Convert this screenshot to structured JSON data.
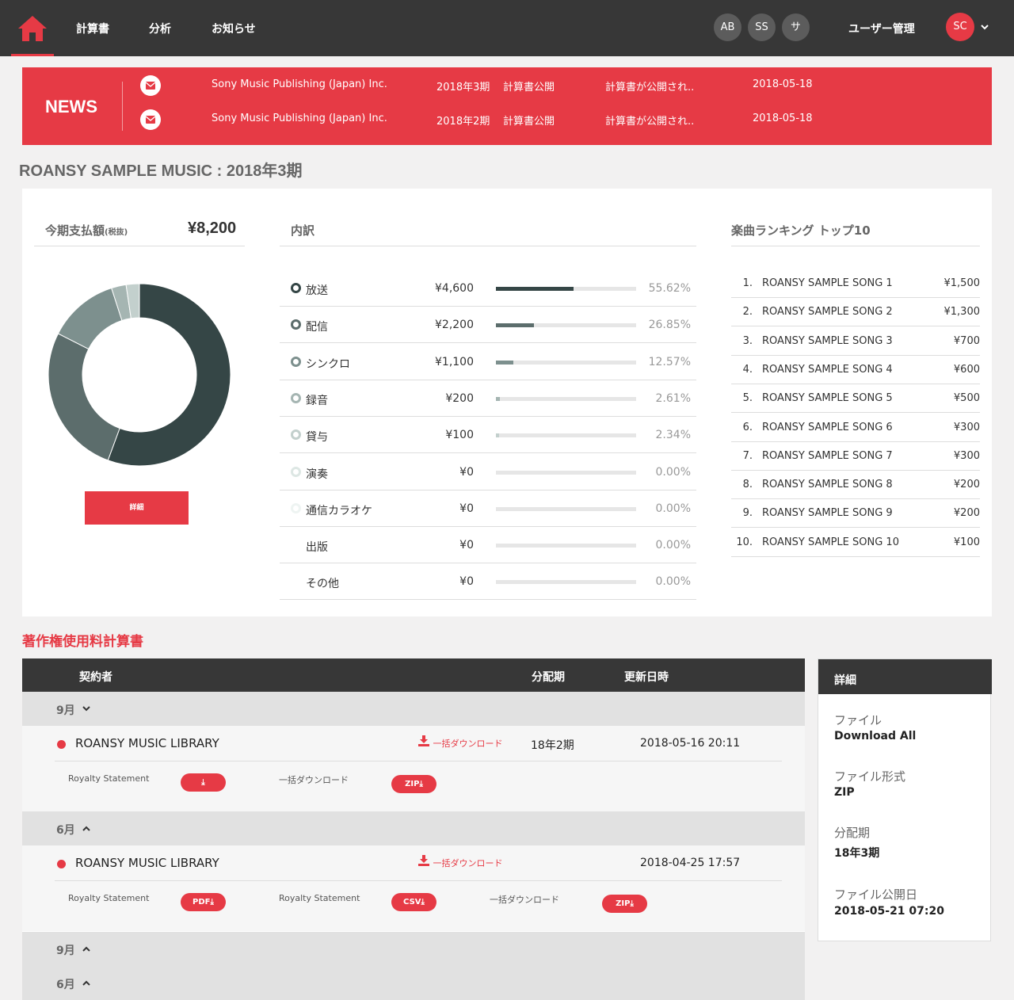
{
  "nav": {
    "items": [
      "計算書",
      "分析",
      "お知らせ"
    ],
    "avatars": [
      "AB",
      "SS",
      "サ"
    ],
    "user_mgmt": "ユーザー管理",
    "me": "SC"
  },
  "news": {
    "title": "NEWS",
    "items": [
      {
        "publisher": "Sony Music Publishing (Japan) Inc.",
        "period": "2018年3期",
        "type": "計算書公開",
        "msg": "計算書が公開され..",
        "date": "2018-05-18"
      },
      {
        "publisher": "Sony Music Publishing (Japan) Inc.",
        "period": "2018年2期",
        "type": "計算書公開",
        "msg": "計算書が公開され..",
        "date": "2018-05-18"
      }
    ]
  },
  "page_title": "ROANSY SAMPLE MUSIC : 2018年3期",
  "summary": {
    "label": "今期支払額",
    "label_small": "(税抜)",
    "total": "¥8,200",
    "detail_button": "詳細"
  },
  "breakdown": {
    "title": "内訳",
    "colors": [
      "#354646",
      "#5c6d6c",
      "#7d908e",
      "#a5b5b2",
      "#c3d0cd",
      "#dde7e4",
      "#eef4f2",
      "#ffffff",
      "#ffffff"
    ],
    "rows": [
      {
        "label": "放送",
        "amount": "¥4,600",
        "pct": "55.62%",
        "ratio": 0.5562
      },
      {
        "label": "配信",
        "amount": "¥2,200",
        "pct": "26.85%",
        "ratio": 0.2685
      },
      {
        "label": "シンクロ",
        "amount": "¥1,100",
        "pct": "12.57%",
        "ratio": 0.1257
      },
      {
        "label": "録音",
        "amount": "¥200",
        "pct": "2.61%",
        "ratio": 0.0261
      },
      {
        "label": "貸与",
        "amount": "¥100",
        "pct": "2.34%",
        "ratio": 0.0234
      },
      {
        "label": "演奏",
        "amount": "¥0",
        "pct": "0.00%",
        "ratio": 0
      },
      {
        "label": "通信カラオケ",
        "amount": "¥0",
        "pct": "0.00%",
        "ratio": 0
      },
      {
        "label": "出版",
        "amount": "¥0",
        "pct": "0.00%",
        "ratio": 0
      },
      {
        "label": "その他",
        "amount": "¥0",
        "pct": "0.00%",
        "ratio": 0
      }
    ]
  },
  "ranking": {
    "title": "楽曲ランキング トップ10",
    "rows": [
      {
        "n": "1.",
        "title": "ROANSY SAMPLE SONG 1",
        "value": "¥1,500"
      },
      {
        "n": "2.",
        "title": "ROANSY SAMPLE SONG 2",
        "value": "¥1,300"
      },
      {
        "n": "3.",
        "title": "ROANSY SAMPLE SONG 3",
        "value": "¥700"
      },
      {
        "n": "4.",
        "title": "ROANSY SAMPLE SONG 4",
        "value": "¥600"
      },
      {
        "n": "5.",
        "title": "ROANSY SAMPLE SONG 5",
        "value": "¥500"
      },
      {
        "n": "6.",
        "title": "ROANSY SAMPLE SONG 6",
        "value": "¥300"
      },
      {
        "n": "7.",
        "title": "ROANSY SAMPLE SONG 7",
        "value": "¥300"
      },
      {
        "n": "8.",
        "title": "ROANSY SAMPLE SONG 8",
        "value": "¥200"
      },
      {
        "n": "9.",
        "title": "ROANSY SAMPLE SONG 9",
        "value": "¥200"
      },
      {
        "n": "10.",
        "title": "ROANSY SAMPLE SONG 10",
        "value": "¥100"
      }
    ]
  },
  "statements": {
    "title": "著作権使用料計算書",
    "headers": {
      "contractor": "契約者",
      "period": "分配期",
      "updated": "更新日時"
    },
    "months": [
      "9月",
      "6月",
      "9月",
      "6月"
    ],
    "rows": [
      {
        "name": "ROANSY MUSIC LIBRARY",
        "download": "一括ダウンロード",
        "period": "18年2期",
        "updated": "2018-05-16 20:11",
        "sub": [
          "Royalty Statement",
          "一括ダウンロード"
        ],
        "pills": [
          "",
          "ZIP"
        ]
      },
      {
        "name": "ROANSY MUSIC LIBRARY",
        "download": "一括ダウンロード",
        "period": "",
        "updated": "2018-04-25 17:57",
        "sub": [
          "Royalty Statement",
          "Royalty Statement",
          "一括ダウンロード"
        ],
        "pills": [
          "PDF",
          "CSV",
          "ZIP"
        ]
      }
    ]
  },
  "side": {
    "title": "詳細",
    "file_label": "ファイル",
    "file_value": "Download All",
    "format_label": "ファイル形式",
    "format_value": "ZIP",
    "period_label": "分配期",
    "period_value": "18年3期",
    "date_label": "ファイル公開日",
    "date_value": "2018-05-21 07:20"
  }
}
